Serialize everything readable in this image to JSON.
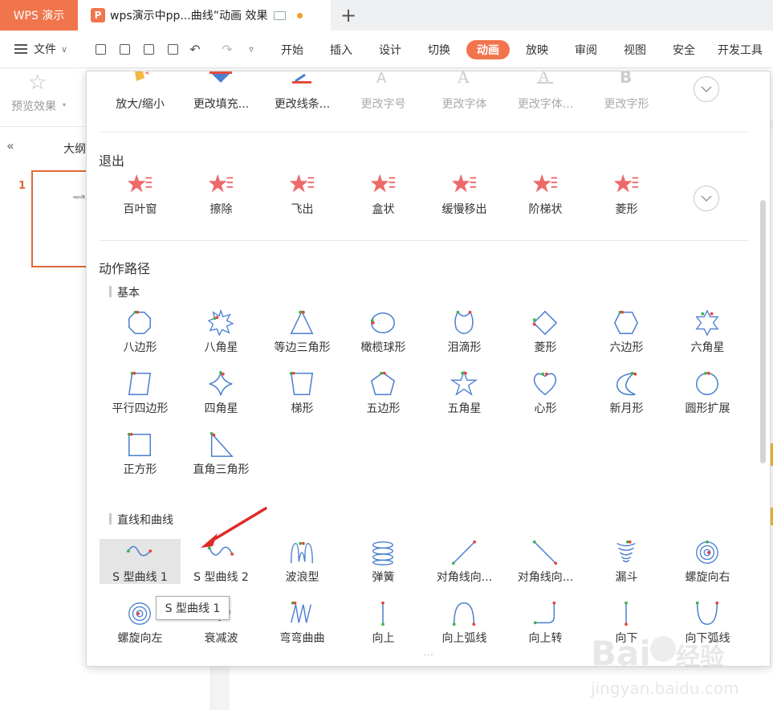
{
  "titlebar": {
    "app_tab": "WPS 演示",
    "doc_tab": "wps演示中pp...曲线”动画 效果",
    "new_tab": "+"
  },
  "menu": {
    "file": "文件",
    "tabs": [
      {
        "label": "开始",
        "active": false
      },
      {
        "label": "插入",
        "active": false
      },
      {
        "label": "设计",
        "active": false
      },
      {
        "label": "切换",
        "active": false
      },
      {
        "label": "动画",
        "active": true
      },
      {
        "label": "放映",
        "active": false
      },
      {
        "label": "审阅",
        "active": false
      },
      {
        "label": "视图",
        "active": false
      },
      {
        "label": "安全",
        "active": false
      },
      {
        "label": "开发工具",
        "active": false
      }
    ]
  },
  "ribbon": {
    "preview": "预览效果"
  },
  "left_pane": {
    "outline": "大纲",
    "slide_number": "1",
    "thumb_text": "wps演"
  },
  "panel": {
    "emphasis_row": [
      "放大/缩小",
      "更改填充...",
      "更改线条...",
      "更改字号",
      "更改字体",
      "更改字体...",
      "更改字形"
    ],
    "exit_title": "退出",
    "exit_row": [
      "百叶窗",
      "擦除",
      "飞出",
      "盒状",
      "缓慢移出",
      "阶梯状",
      "菱形"
    ],
    "path_title": "动作路径",
    "basic_title": "基本",
    "basic": [
      "八边形",
      "八角星",
      "等边三角形",
      "橄榄球形",
      "泪滴形",
      "菱形",
      "六边形",
      "六角星",
      "平行四边形",
      "四角星",
      "梯形",
      "五边形",
      "五角星",
      "心形",
      "新月形",
      "圆形扩展",
      "正方形",
      "直角三角形"
    ],
    "lines_title": "直线和曲线",
    "lines": [
      "S 型曲线 1",
      "S 型曲线 2",
      "波浪型",
      "弹簧",
      "对角线向...",
      "对角线向...",
      "漏斗",
      "螺旋向右",
      "螺旋向左",
      "衰减波",
      "弯弯曲曲",
      "向上",
      "向上弧线",
      "向上转",
      "向下",
      "向下弧线"
    ],
    "grip": "···",
    "tooltip": "S 型曲线 1"
  },
  "colors": {
    "accent": "#f1754c",
    "path": "#4a7fd0",
    "start": "#3bb34a",
    "end": "#e8413c"
  },
  "watermark": {
    "brand": "Bai",
    "brand2": "du",
    "cn": "经验",
    "url": "jingyan.baidu.com"
  }
}
